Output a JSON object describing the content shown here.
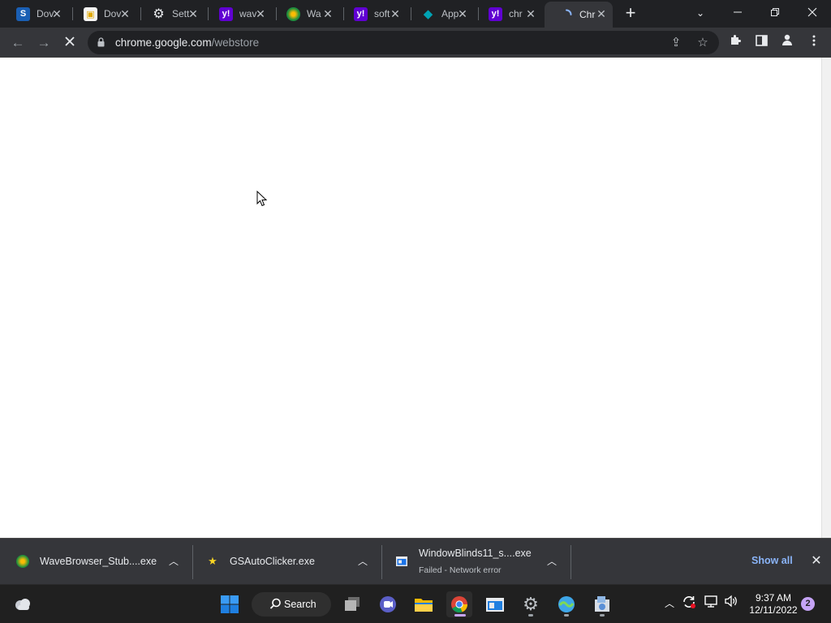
{
  "browser": {
    "tabs": [
      {
        "title": "Dov",
        "favicon": "softpedia-icon",
        "color": "#1a5fb4"
      },
      {
        "title": "Dov",
        "favicon": "download-doc-icon",
        "color": "#f5f5f5"
      },
      {
        "title": "Sett",
        "favicon": "gear-icon",
        "color": "#e8eaed"
      },
      {
        "title": "wav",
        "favicon": "yahoo-icon",
        "color": "#6001d2"
      },
      {
        "title": "Wa",
        "favicon": "wave-icon",
        "color": "#1e8e3e"
      },
      {
        "title": "soft",
        "favicon": "yahoo-icon",
        "color": "#6001d2"
      },
      {
        "title": "App",
        "favicon": "app-icon",
        "color": "#00a3b4"
      },
      {
        "title": "chr",
        "favicon": "yahoo-icon",
        "color": "#6001d2"
      },
      {
        "title": "Chr",
        "favicon": "loading-spinner-icon",
        "color": "#8ab4f8",
        "active": true
      }
    ],
    "url": {
      "host": "chrome.google.com",
      "path": "/webstore"
    }
  },
  "downloads": {
    "items": [
      {
        "name": "WaveBrowser_Stub....exe",
        "status": "",
        "icon": "wave-icon"
      },
      {
        "name": "GSAutoClicker.exe",
        "status": "",
        "icon": "star-icon"
      },
      {
        "name": "WindowBlinds11_s....exe",
        "status": "Failed - Network error",
        "icon": "installer-icon"
      }
    ],
    "show_all": "Show all"
  },
  "taskbar": {
    "search_label": "Search",
    "time": "9:37 AM",
    "date": "12/11/2022",
    "notification_count": "2"
  }
}
